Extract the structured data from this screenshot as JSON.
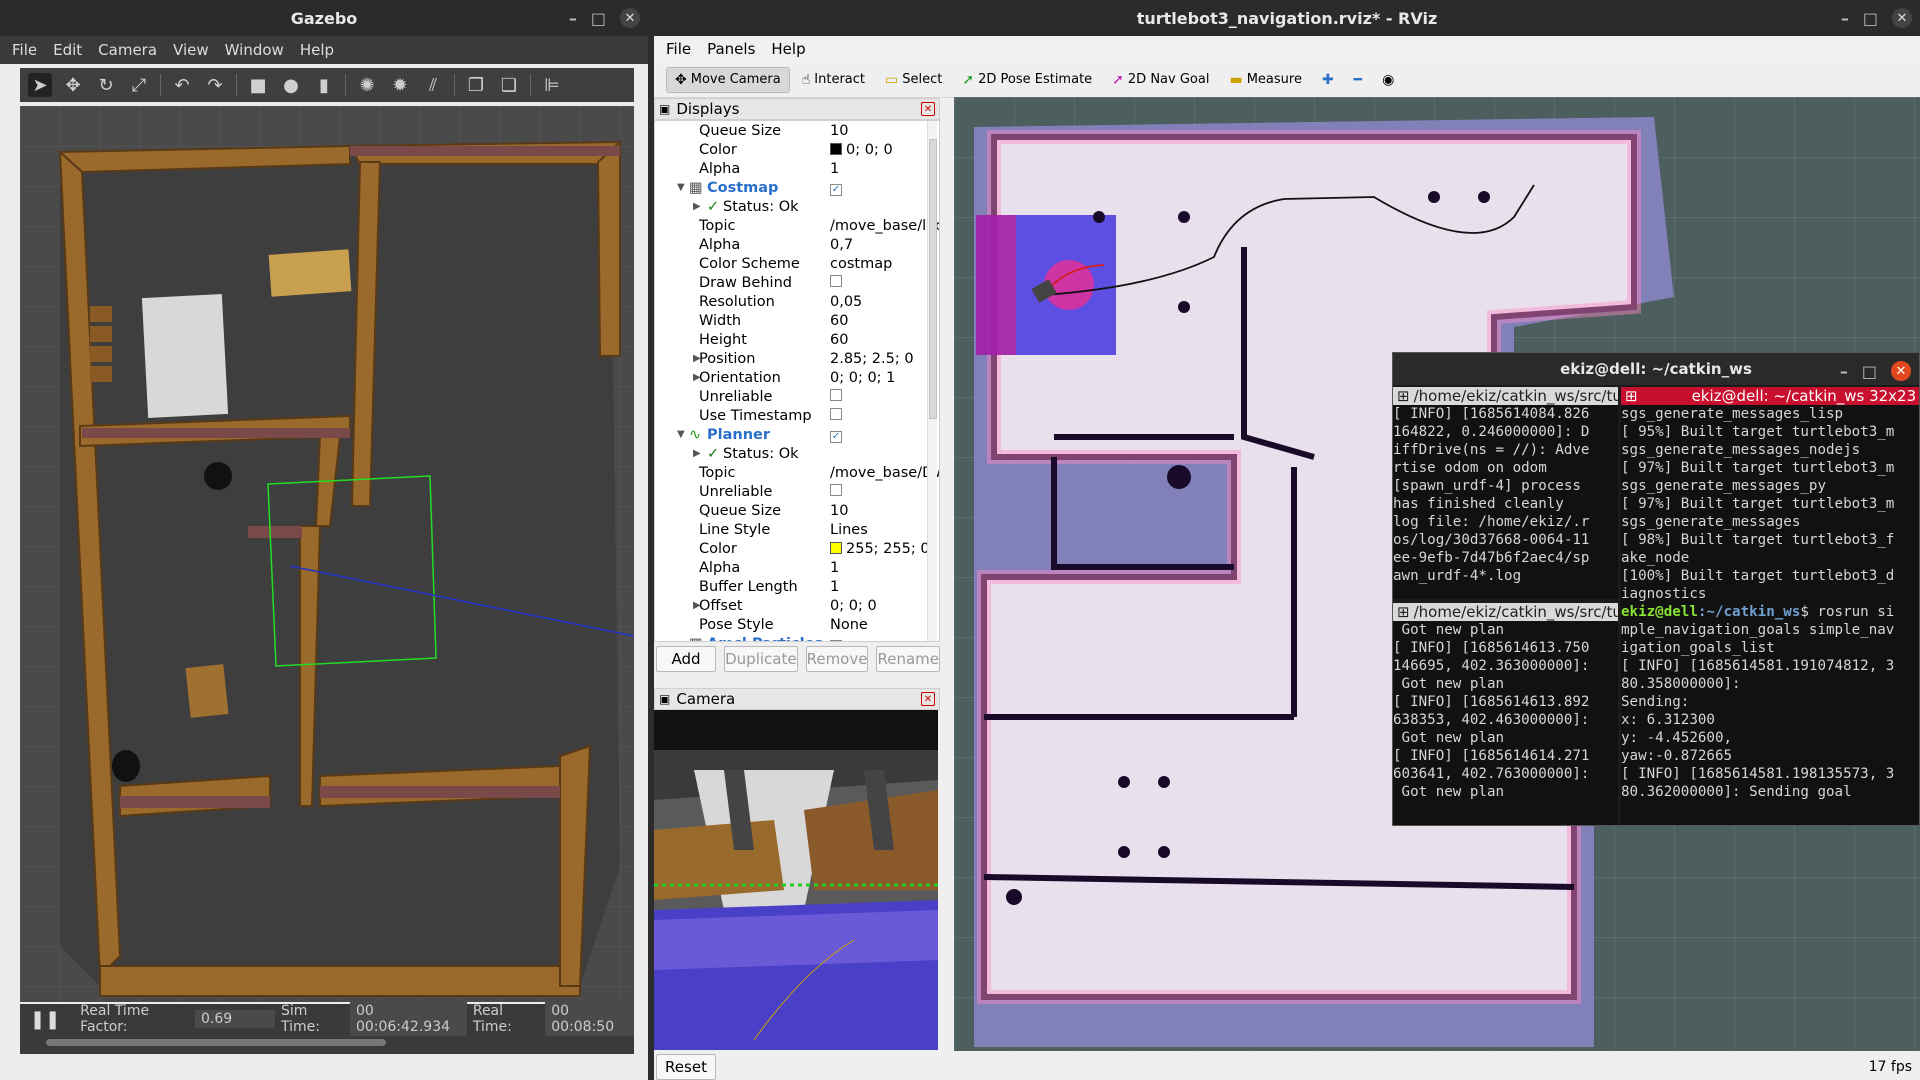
{
  "gazebo": {
    "title": "Gazebo",
    "menu": [
      "File",
      "Edit",
      "Camera",
      "View",
      "Window",
      "Help"
    ],
    "status": {
      "rtf_label": "Real Time Factor:",
      "rtf_value": "0.69",
      "sim_label": "Sim Time:",
      "sim_value": "00 00:06:42.934",
      "real_label": "Real Time:",
      "real_value": "00 00:08:50"
    }
  },
  "rviz": {
    "title": "turtlebot3_navigation.rviz* - RViz",
    "menu": [
      "File",
      "Panels",
      "Help"
    ],
    "tools": [
      "Move Camera",
      "Interact",
      "Select",
      "2D Pose Estimate",
      "2D Nav Goal",
      "Measure"
    ],
    "displays_title": "Displays",
    "camera_title": "Camera",
    "buttons": [
      "Add",
      "Duplicate",
      "Remove",
      "Rename"
    ],
    "reset": "Reset",
    "fps": "17 fps",
    "tree": [
      {
        "name": "Queue Size",
        "value": "10"
      },
      {
        "name": "Color",
        "value": "0; 0; 0"
      },
      {
        "name": "Alpha",
        "value": "1"
      },
      {
        "name": "Costmap",
        "value": ""
      },
      {
        "name": "Status: Ok",
        "value": ""
      },
      {
        "name": "Topic",
        "value": "/move_base/local_c..."
      },
      {
        "name": "Alpha",
        "value": "0,7"
      },
      {
        "name": "Color Scheme",
        "value": "costmap"
      },
      {
        "name": "Draw Behind",
        "value": ""
      },
      {
        "name": "Resolution",
        "value": "0,05"
      },
      {
        "name": "Width",
        "value": "60"
      },
      {
        "name": "Height",
        "value": "60"
      },
      {
        "name": "Position",
        "value": "2.85; 2.5; 0"
      },
      {
        "name": "Orientation",
        "value": "0; 0; 0; 1"
      },
      {
        "name": "Unreliable",
        "value": ""
      },
      {
        "name": "Use Timestamp",
        "value": ""
      },
      {
        "name": "Planner",
        "value": ""
      },
      {
        "name": "Status: Ok",
        "value": ""
      },
      {
        "name": "Topic",
        "value": "/move_base/DWAPl..."
      },
      {
        "name": "Unreliable",
        "value": ""
      },
      {
        "name": "Queue Size",
        "value": "10"
      },
      {
        "name": "Line Style",
        "value": "Lines"
      },
      {
        "name": "Color",
        "value": "255; 255; 0"
      },
      {
        "name": "Alpha",
        "value": "1"
      },
      {
        "name": "Buffer Length",
        "value": "1"
      },
      {
        "name": "Offset",
        "value": "0; 0; 0"
      },
      {
        "name": "Pose Style",
        "value": "None"
      },
      {
        "name": "Amcl Particles",
        "value": ""
      }
    ],
    "colors": {
      "black_swatch": "#000000",
      "yellow_swatch": "#ffff00",
      "accent_blue": "#2a6fc9"
    }
  },
  "terminal": {
    "title": "ekiz@dell: ~/catkin_ws",
    "pane1_path": "/home/ekiz/catkin_ws/src/tur",
    "pane2_path": "/home/ekiz/catkin_ws/src/tur",
    "pane3_title": "ekiz@dell: ~/catkin_ws 32x23",
    "pane1_lines": [
      "[ INFO] [1685614084.826",
      "164822, 0.246000000]: D",
      "iffDrive(ns = //): Adve",
      "rtise odom on odom",
      "[spawn_urdf-4] process",
      "has finished cleanly",
      "log file: /home/ekiz/.r",
      "os/log/30d37668-0064-11",
      "ee-9efb-7d47b6f2aec4/sp",
      "awn_urdf-4*.log"
    ],
    "pane2_lines": [
      " Got new plan",
      "[ INFO] [1685614613.750",
      "146695, 402.363000000]:",
      " Got new plan",
      "[ INFO] [1685614613.892",
      "638353, 402.463000000]:",
      " Got new plan",
      "[ INFO] [1685614614.271",
      "603641, 402.763000000]:",
      " Got new plan"
    ],
    "pane3_lines": [
      "sgs_generate_messages_lisp",
      "[ 95%] Built target turtlebot3_m",
      "sgs_generate_messages_nodejs",
      "[ 97%] Built target turtlebot3_m",
      "sgs_generate_messages_py",
      "[ 97%] Built target turtlebot3_m",
      "sgs_generate_messages",
      "[ 98%] Built target turtlebot3_f",
      "ake_node",
      "[100%] Built target turtlebot3_d",
      "iagnostics"
    ],
    "prompt_user": "ekiz@dell",
    "prompt_path": ":~/catkin_ws",
    "prompt_cmd": "$ rosrun si",
    "pane3_after": [
      "mple_navigation_goals simple_nav",
      "igation_goals_list",
      "[ INFO] [1685614581.191074812, 3",
      "80.358000000]:",
      "Sending:",
      "x: 6.312300",
      "y: -4.452600,",
      "yaw:-0.872665",
      "[ INFO] [1685614581.198135573, 3",
      "80.362000000]: Sending goal"
    ]
  }
}
